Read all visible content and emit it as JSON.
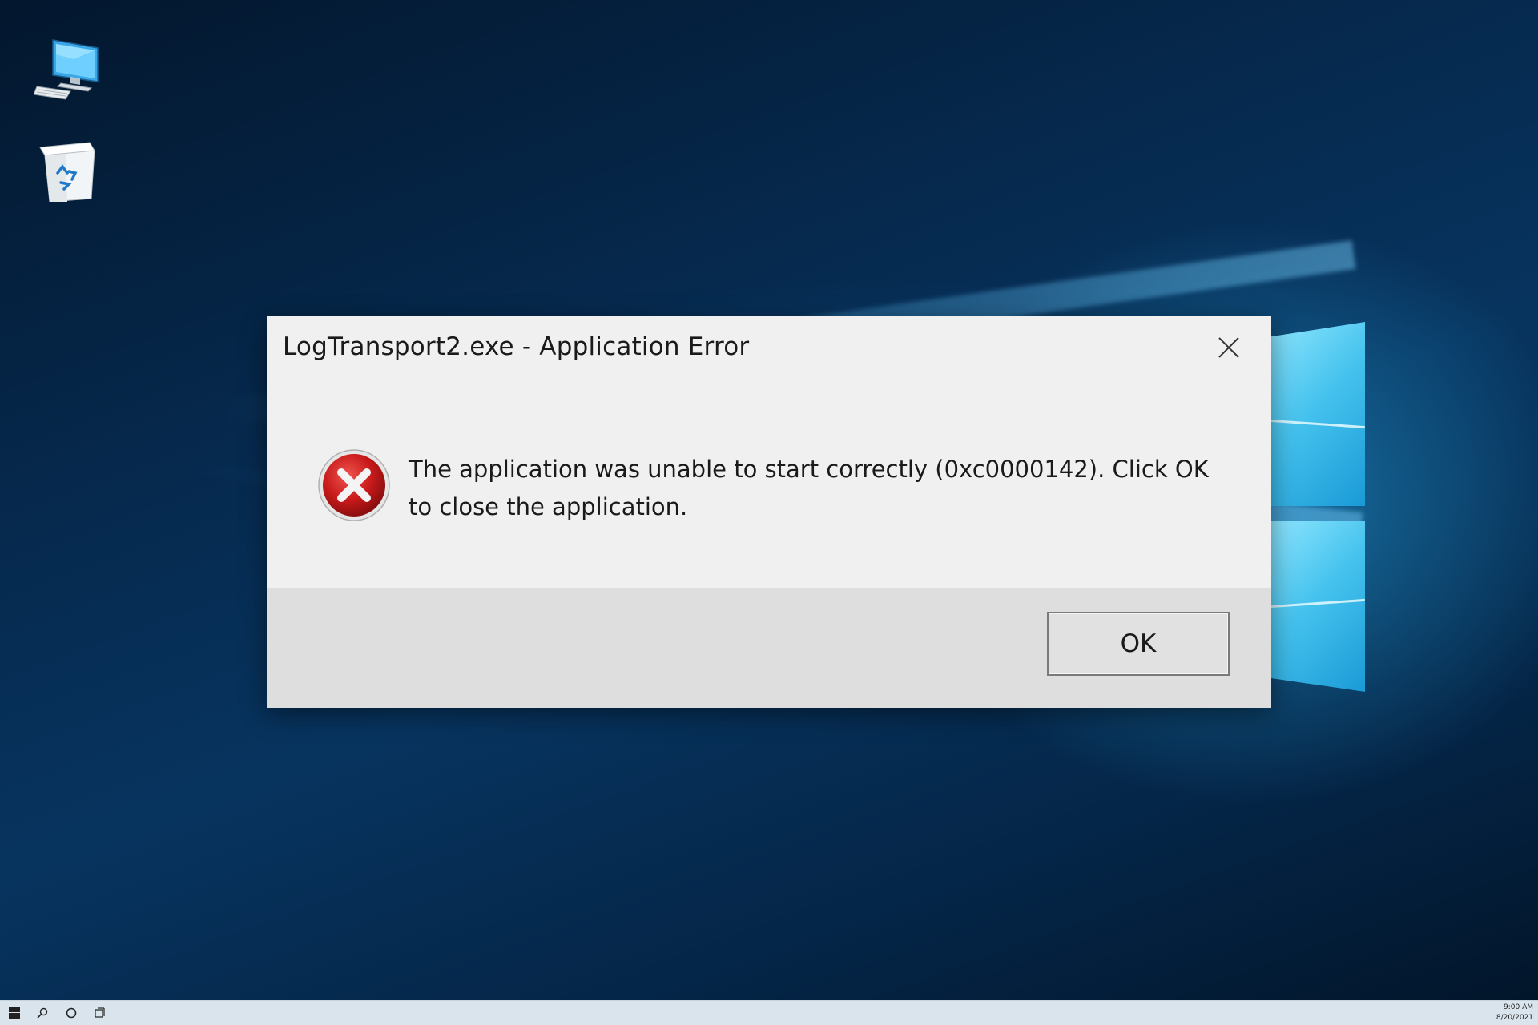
{
  "desktop": {
    "icons": [
      {
        "name": "this-pc-icon"
      },
      {
        "name": "recycle-bin-icon"
      }
    ]
  },
  "dialog": {
    "title": "LogTransport2.exe - Application Error",
    "message": "The application was unable to start correctly (0xc0000142). Click OK to close the application.",
    "ok_label": "OK",
    "close_icon": "close-icon",
    "status_icon": "error-icon"
  },
  "taskbar": {
    "icons": [
      "start-icon",
      "search-icon",
      "cortana-icon",
      "task-view-icon"
    ],
    "time": "9:00 AM",
    "date": "8/20/2021"
  },
  "colors": {
    "dialog_bg": "#f0f0f0",
    "dialog_footer_bg": "#dedede",
    "error_red": "#c8191a",
    "desktop_blue": "#062a4f",
    "logo_cyan": "#46c3ee"
  }
}
